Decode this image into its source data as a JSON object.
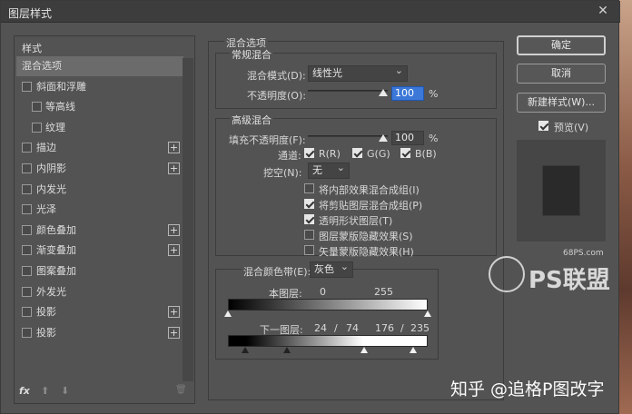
{
  "window": {
    "title": "图层样式",
    "close_glyph": "✕"
  },
  "left_panel": {
    "header": "样式",
    "items": [
      {
        "label": "混合选项",
        "checkbox": false,
        "plus": false,
        "selected": true
      },
      {
        "label": "斜面和浮雕",
        "checkbox": true,
        "checked": false,
        "plus": false
      },
      {
        "label": "等高线",
        "checkbox": true,
        "checked": false,
        "plus": false,
        "indent": true
      },
      {
        "label": "纹理",
        "checkbox": true,
        "checked": false,
        "plus": false,
        "indent": true
      },
      {
        "label": "描边",
        "checkbox": true,
        "checked": false,
        "plus": true
      },
      {
        "label": "内阴影",
        "checkbox": true,
        "checked": false,
        "plus": true
      },
      {
        "label": "内发光",
        "checkbox": true,
        "checked": false,
        "plus": false
      },
      {
        "label": "光泽",
        "checkbox": true,
        "checked": false,
        "plus": false
      },
      {
        "label": "颜色叠加",
        "checkbox": true,
        "checked": false,
        "plus": true
      },
      {
        "label": "渐变叠加",
        "checkbox": true,
        "checked": false,
        "plus": true
      },
      {
        "label": "图案叠加",
        "checkbox": true,
        "checked": false,
        "plus": false
      },
      {
        "label": "外发光",
        "checkbox": true,
        "checked": false,
        "plus": false
      },
      {
        "label": "投影",
        "checkbox": true,
        "checked": false,
        "plus": true
      },
      {
        "label": "投影",
        "checkbox": true,
        "checked": false,
        "plus": true
      }
    ],
    "plus_glyph": "+",
    "footer": {
      "fx": "fx",
      "up": "⬆",
      "down": "⬇",
      "trash": "🗑"
    }
  },
  "blend": {
    "section": "混合选项",
    "general": "常规混合",
    "mode_label": "混合模式(D):",
    "mode_value": "线性光",
    "opacity_label": "不透明度(O):",
    "opacity_value": "100",
    "percent": "%",
    "advanced": "高级混合",
    "fill_label": "填充不透明度(F):",
    "fill_value": "100",
    "channels_label": "通道:",
    "ch_r": "R(R)",
    "ch_g": "G(G)",
    "ch_b": "B(B)",
    "knockout_label": "挖空(N):",
    "knockout_value": "无",
    "options": [
      {
        "label": "将内部效果混合成组(I)",
        "checked": false
      },
      {
        "label": "将剪贴图层混合成组(P)",
        "checked": true
      },
      {
        "label": "透明形状图层(T)",
        "checked": true
      },
      {
        "label": "图层蒙版隐藏效果(S)",
        "checked": false
      },
      {
        "label": "矢量蒙版隐藏效果(H)",
        "checked": false
      }
    ],
    "blendif_label": "混合颜色带(E):",
    "blendif_value": "灰色",
    "this_layer": "本图层:",
    "this_low": "0",
    "this_high": "255",
    "under_layer": "下一图层:",
    "under_a": "24",
    "under_slash1": "/",
    "under_b": "74",
    "under_c": "176",
    "under_slash2": "/",
    "under_d": "235"
  },
  "buttons": {
    "ok": "确定",
    "cancel": "取消",
    "new_style": "新建样式(W)...",
    "preview": "预览(V)"
  },
  "watermarks": {
    "site": "68PS.com",
    "logo": "PS联盟",
    "zhihu": "知乎 @追格P图改字"
  }
}
